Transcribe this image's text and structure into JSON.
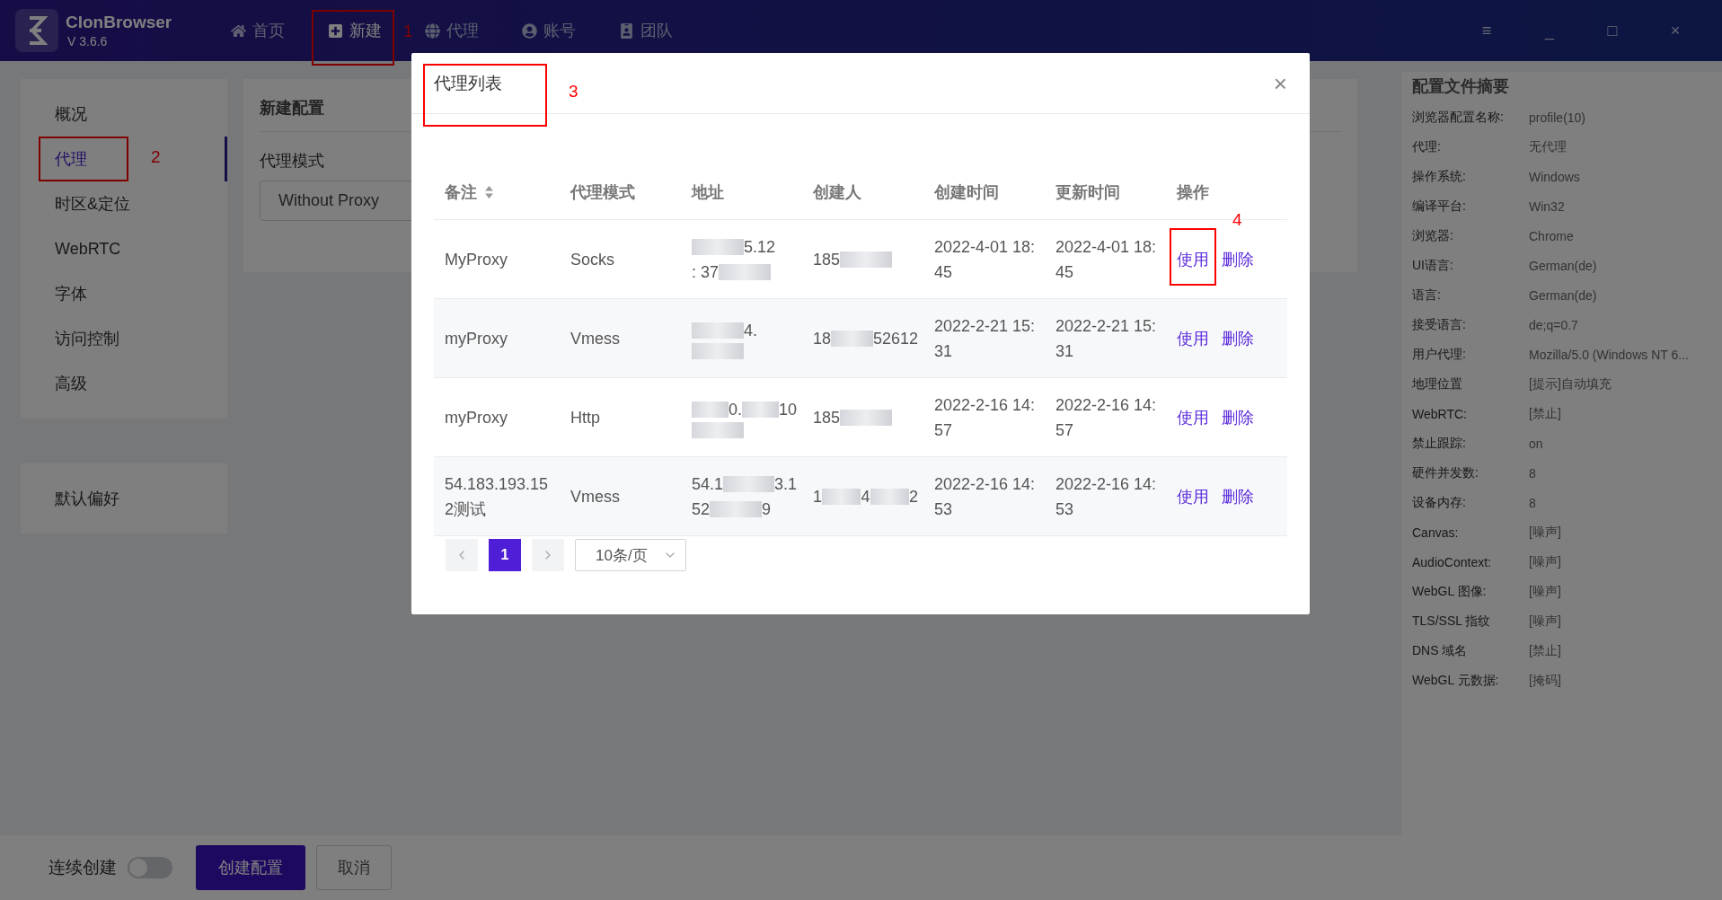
{
  "app": {
    "name": "ClonBrowser",
    "version": "V 3.6.6"
  },
  "nav": [
    {
      "label": "首页",
      "selected": false
    },
    {
      "label": "新建",
      "selected": true,
      "annotation": "1"
    },
    {
      "label": "代理",
      "selected": false
    },
    {
      "label": "账号",
      "selected": false
    },
    {
      "label": "团队",
      "selected": false
    }
  ],
  "window_controls": [
    "≡",
    "_",
    "□",
    "×"
  ],
  "sidebar": {
    "items": [
      {
        "label": "概况",
        "selected": false
      },
      {
        "label": "代理",
        "selected": true,
        "annotation": "2"
      },
      {
        "label": "时区&定位",
        "selected": false
      },
      {
        "label": "WebRTC",
        "selected": false
      },
      {
        "label": "字体",
        "selected": false
      },
      {
        "label": "访问控制",
        "selected": false
      },
      {
        "label": "高级",
        "selected": false
      }
    ],
    "extra": [
      {
        "label": "默认偏好",
        "selected": false
      }
    ]
  },
  "config": {
    "title": "新建配置",
    "field_label": "代理模式",
    "select_value": "Without Proxy"
  },
  "summary": {
    "title": "配置文件摘要",
    "rows": [
      {
        "label": "浏览器配置名称:",
        "value": "profile(10)"
      },
      {
        "label": "代理:",
        "value": "无代理"
      },
      {
        "label": "操作系统:",
        "value": "Windows"
      },
      {
        "label": "编译平台:",
        "value": "Win32"
      },
      {
        "label": "浏览器:",
        "value": "Chrome"
      },
      {
        "label": "UI语言:",
        "value": "German(de)"
      },
      {
        "label": "语言:",
        "value": "German(de)"
      },
      {
        "label": "接受语言:",
        "value": "de;q=0.7"
      },
      {
        "label": "用户代理:",
        "value": "Mozilla/5.0 (Windows NT 6..."
      },
      {
        "label": "地理位置",
        "value": "[提示]自动填充"
      },
      {
        "label": "WebRTC:",
        "value": "[禁止]"
      },
      {
        "label": "禁止跟踪:",
        "value": "on"
      },
      {
        "label": "硬件并发数:",
        "value": "8"
      },
      {
        "label": "设备内存:",
        "value": "8"
      },
      {
        "label": "Canvas:",
        "value": "[噪声]"
      },
      {
        "label": "AudioContext:",
        "value": "[噪声]"
      },
      {
        "label": "WebGL 图像:",
        "value": "[噪声]"
      },
      {
        "label": "TLS/SSL 指纹",
        "value": "[噪声]"
      },
      {
        "label": "DNS 域名",
        "value": "[禁止]"
      },
      {
        "label": "WebGL 元数据:",
        "value": "[掩码]"
      }
    ]
  },
  "bottom": {
    "toggle_label": "连续创建",
    "toggle_on": false,
    "primary": "创建配置",
    "cancel": "取消"
  },
  "modal": {
    "title": "代理列表",
    "annotation": "3",
    "close": "×",
    "columns": [
      {
        "label": "备注",
        "kind": "sortable"
      },
      {
        "label": "代理模式",
        "kind": "plain"
      },
      {
        "label": "地址",
        "kind": "plain"
      },
      {
        "label": "创建人",
        "kind": "plain"
      },
      {
        "label": "创建时间",
        "kind": "plain"
      },
      {
        "label": "更新时间",
        "kind": "plain"
      },
      {
        "label": "操作",
        "kind": "plain"
      }
    ],
    "rows": [
      {
        "note": "MyProxy",
        "mode": "Socks",
        "address": [
          [
            {
              "kind": "blur"
            },
            {
              "kind": "text",
              "text": "5.12"
            }
          ],
          [
            {
              "kind": "text",
              "text": ": 37"
            },
            {
              "kind": "blur"
            }
          ]
        ],
        "creator": [
          [
            {
              "kind": "text",
              "text": "185"
            },
            {
              "kind": "blur"
            }
          ]
        ],
        "created": "2022-4-01 18:45",
        "updated": "2022-4-01 18:45",
        "use": "使用",
        "delete": "删除",
        "annotation": "4"
      },
      {
        "note": "myProxy",
        "mode": "Vmess",
        "address": [
          [
            {
              "kind": "blur"
            },
            {
              "kind": "text",
              "text": "4."
            }
          ],
          [
            {
              "kind": "blur"
            }
          ]
        ],
        "creator": [
          [
            {
              "kind": "text",
              "text": "18"
            },
            {
              "kind": "blur"
            },
            {
              "kind": "text",
              "text": "52612"
            }
          ]
        ],
        "created": "2022-2-21 15:31",
        "updated": "2022-2-21 15:31",
        "use": "使用",
        "delete": "删除"
      },
      {
        "note": "myProxy",
        "mode": "Http",
        "address": [
          [
            {
              "kind": "blur"
            },
            {
              "kind": "text",
              "text": "0."
            },
            {
              "kind": "blur"
            },
            {
              "kind": "text",
              "text": "10"
            }
          ],
          [
            {
              "kind": "blur"
            }
          ]
        ],
        "creator": [
          [
            {
              "kind": "text",
              "text": "185"
            },
            {
              "kind": "blur"
            }
          ]
        ],
        "created": "2022-2-16 14:57",
        "updated": "2022-2-16 14:57",
        "use": "使用",
        "delete": "删除"
      },
      {
        "note": "54.183.193.152测试",
        "mode": "Vmess",
        "address": [
          [
            {
              "kind": "text",
              "text": "54.1"
            },
            {
              "kind": "blur"
            },
            {
              "kind": "text",
              "text": "3.1"
            }
          ],
          [
            {
              "kind": "text",
              "text": "52"
            },
            {
              "kind": "blur"
            },
            {
              "kind": "text",
              "text": "9"
            }
          ]
        ],
        "creator": [
          [
            {
              "kind": "text",
              "text": "1"
            },
            {
              "kind": "blur"
            },
            {
              "kind": "text",
              "text": "4"
            },
            {
              "kind": "blur"
            },
            {
              "kind": "text",
              "text": "2"
            }
          ]
        ],
        "created": "2022-2-16 14:53",
        "updated": "2022-2-16 14:53",
        "use": "使用",
        "delete": "删除"
      }
    ],
    "pagination": {
      "pages": [
        {
          "label": "1",
          "selected": true
        }
      ],
      "page_size": "10条/页"
    }
  }
}
